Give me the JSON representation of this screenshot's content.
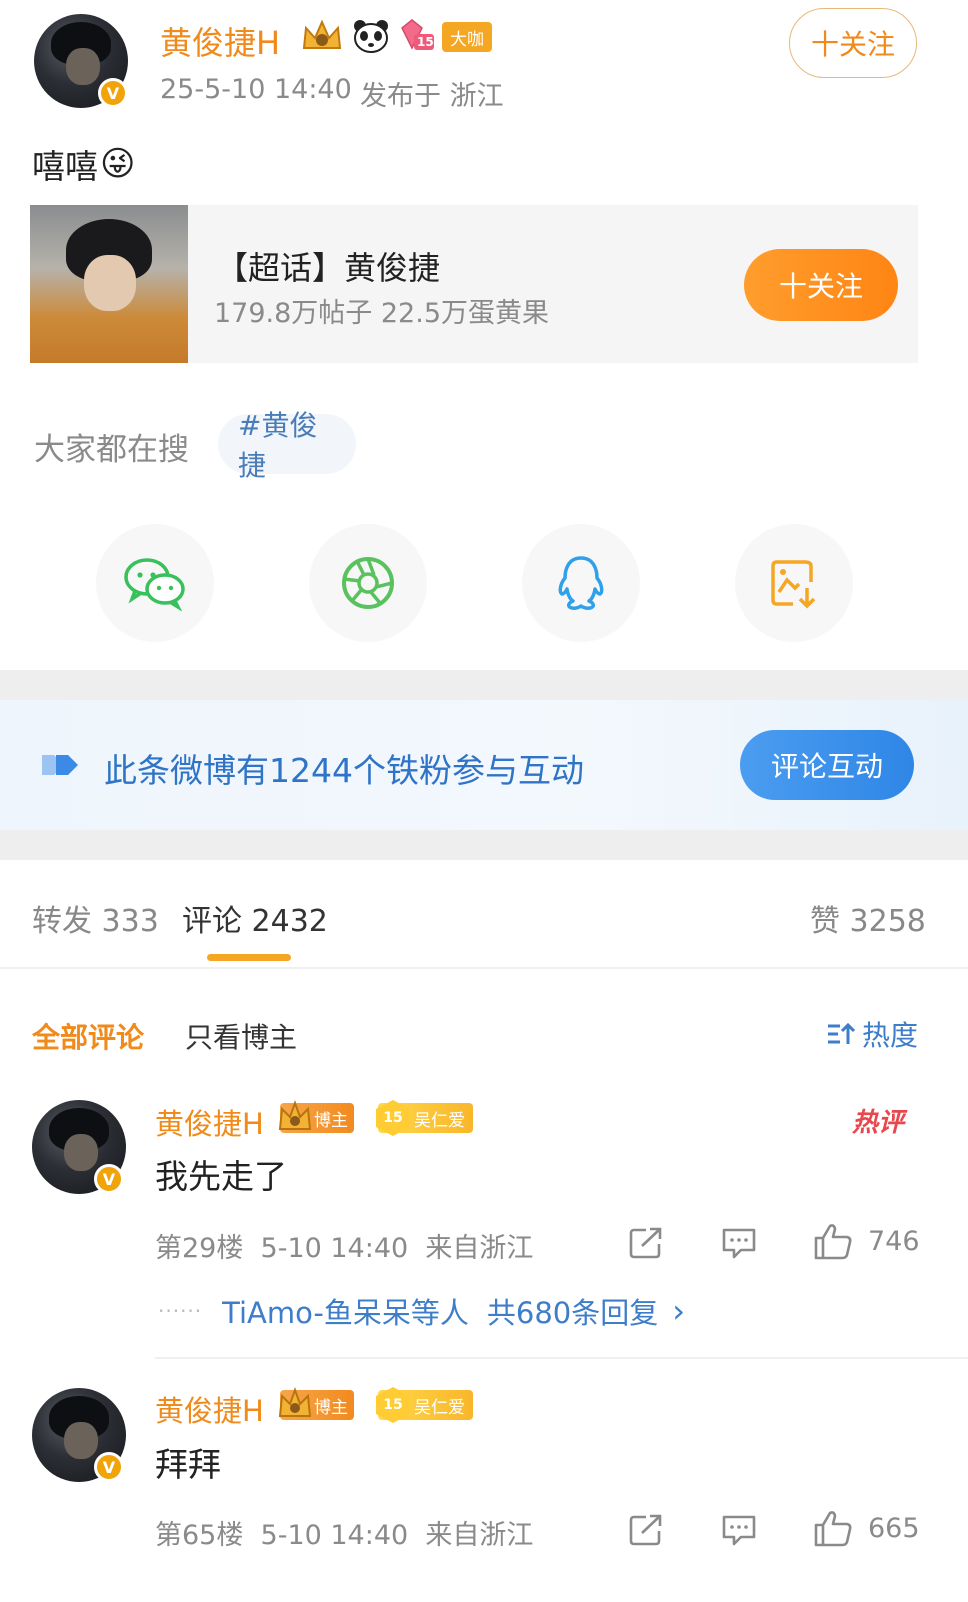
{
  "post": {
    "author": "黄俊捷H",
    "medals": {
      "vip_label": "大咖",
      "fan_level": "15"
    },
    "follow_label": "十关注",
    "timestamp": "25-5-10 14:40",
    "location": "发布于 浙江",
    "text": "嘻嘻",
    "emoji": "😜"
  },
  "topic": {
    "title": "【超话】黄俊捷",
    "stats": "179.8万帖子 22.5万蛋黄果",
    "follow_label": "十关注"
  },
  "search": {
    "label": "大家都在搜",
    "chip": "#黄俊捷"
  },
  "share": [
    {
      "icon": "wechat-icon",
      "color": "#38c05b"
    },
    {
      "icon": "moments-icon",
      "color": "#59c15e"
    },
    {
      "icon": "qq-icon",
      "color": "#2fa0ea"
    },
    {
      "icon": "save-image-icon",
      "color": "#f5a623"
    }
  ],
  "fans_banner": {
    "text": "此条微博有1244个铁粉参与互动",
    "button": "评论互动"
  },
  "tabs": {
    "repost": "转发 333",
    "comment": "评论 2432",
    "like": "赞 3258"
  },
  "filter": {
    "all": "全部评论",
    "host_only": "只看博主",
    "sort": "热度"
  },
  "comments": [
    {
      "name": "黄俊捷H",
      "host_tag": "博主",
      "fan_tag": "吴仁爱",
      "fan_level": "15",
      "text": "我先走了",
      "meta": "第29楼  5-10 14:40  来自浙江",
      "likes": "746",
      "hot": "热评",
      "replies_dots": "······",
      "replies_user": "TiAmo-鱼呆呆等人",
      "replies_count": "共680条回复",
      "replies_arrow": "›"
    },
    {
      "name": "黄俊捷H",
      "host_tag": "博主",
      "fan_tag": "吴仁爱",
      "fan_level": "15",
      "text": "拜拜",
      "meta": "第65楼  5-10 14:40  来自浙江",
      "likes": "665"
    }
  ],
  "colors": {
    "accent": "#f08a1b",
    "link": "#3d7dc9",
    "muted": "#8a8a8a"
  }
}
